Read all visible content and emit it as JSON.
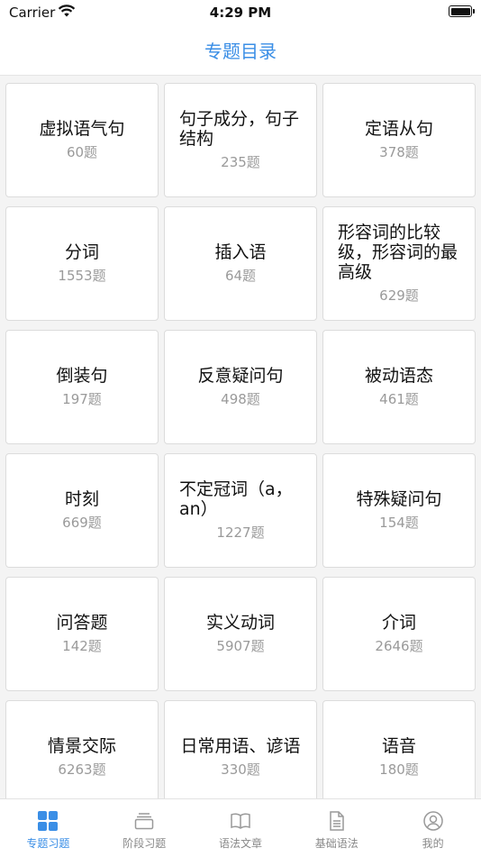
{
  "status_bar": {
    "carrier": "Carrier",
    "time": "4:29 PM"
  },
  "nav": {
    "title": "专题目录"
  },
  "topics": [
    {
      "title": "虚拟语气句",
      "count": "60题"
    },
    {
      "title": "句子成分，句子结构",
      "count": "235题"
    },
    {
      "title": "定语从句",
      "count": "378题"
    },
    {
      "title": "分词",
      "count": "1553题"
    },
    {
      "title": "插入语",
      "count": "64题"
    },
    {
      "title": "形容词的比较级，形容词的最高级",
      "count": "629题"
    },
    {
      "title": "倒装句",
      "count": "197题"
    },
    {
      "title": "反意疑问句",
      "count": "498题"
    },
    {
      "title": "被动语态",
      "count": "461题"
    },
    {
      "title": "时刻",
      "count": "669题"
    },
    {
      "title": "不定冠词（a，an）",
      "count": "1227题"
    },
    {
      "title": "特殊疑问句",
      "count": "154题"
    },
    {
      "title": "问答题",
      "count": "142题"
    },
    {
      "title": "实义动词",
      "count": "5907题"
    },
    {
      "title": "介词",
      "count": "2646题"
    },
    {
      "title": "情景交际",
      "count": "6263题"
    },
    {
      "title": "日常用语、谚语",
      "count": "330题"
    },
    {
      "title": "语音",
      "count": "180题"
    }
  ],
  "tabs": [
    {
      "label": "专题习题",
      "icon": "grid-icon"
    },
    {
      "label": "阶段习题",
      "icon": "stack-icon"
    },
    {
      "label": "语法文章",
      "icon": "book-icon"
    },
    {
      "label": "基础语法",
      "icon": "document-icon"
    },
    {
      "label": "我的",
      "icon": "profile-icon"
    }
  ],
  "colors": {
    "accent": "#3a8ee6",
    "inactive": "#888888",
    "count_text": "#9a9a9a",
    "background": "#f4f4f4"
  }
}
